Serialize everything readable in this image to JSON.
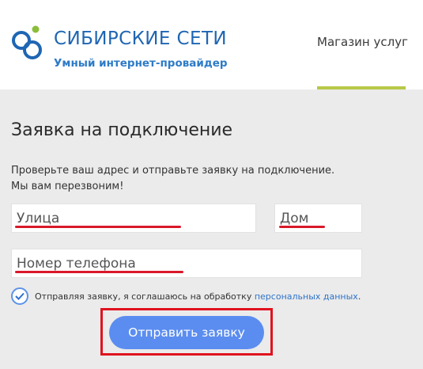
{
  "header": {
    "brand_name": "СИБИРСКИЕ СЕТИ",
    "brand_tagline": "Умный интернет-провайдер",
    "logo_icon": "sibirskie-seti-logo",
    "nav_shop": "Магазин услуг",
    "accent_color": "#b8c848",
    "brand_color": "#1f66b3"
  },
  "form": {
    "title": "Заявка на подключение",
    "intro_line1": "Проверьте ваш адрес и отправьте заявку на подключение.",
    "intro_line2": "Мы вам перезвоним!",
    "street_placeholder": "Улица",
    "house_placeholder": "Дом",
    "phone_placeholder": "Номер телефона",
    "consent_checked": true,
    "consent_text": "Отправляя заявку, я соглашаюсь на обработку",
    "consent_link": "персональных данных",
    "consent_end": ".",
    "submit_label": "Отправить заявку",
    "button_color": "#5b8df0",
    "annotation_color": "#d8192a"
  }
}
